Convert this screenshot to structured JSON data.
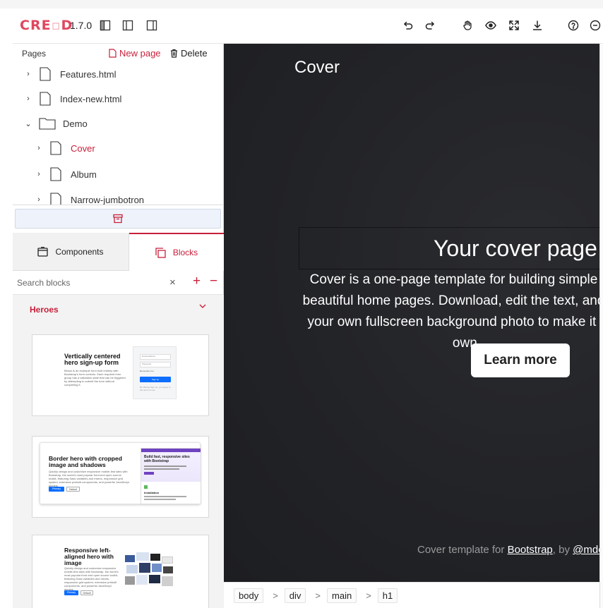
{
  "toolbar": {
    "logo_left": "CRE",
    "logo_mid": "▫",
    "logo_right": "D",
    "version": "1.7.0"
  },
  "pages": {
    "title": "Pages",
    "new_page_label": "New page",
    "delete_label": "Delete",
    "items": [
      {
        "label": "Features.html",
        "type": "file"
      },
      {
        "label": "Index-new.html",
        "type": "file"
      },
      {
        "label": "Demo",
        "type": "folder"
      },
      {
        "label": "Cover",
        "type": "file"
      },
      {
        "label": "Album",
        "type": "file"
      },
      {
        "label": "Narrow-jumbotron",
        "type": "file"
      }
    ]
  },
  "tabs": {
    "components_label": "Components",
    "blocks_label": "Blocks"
  },
  "search": {
    "placeholder": "Search blocks",
    "clear": "×",
    "plus": "+",
    "minus": "−"
  },
  "blocks": {
    "group_title": "Heroes",
    "cards": [
      {
        "title": "Vertically centered hero sign-up form",
        "text": "Below is an example form built entirely with Bootstrap's form controls. Each required form group has a validation state that can be triggered by attempting to submit the form without completing it.",
        "field1": "Email address",
        "field2": "Password",
        "check": "Remember me",
        "button": "Sign up",
        "note": "By clicking Sign up, you agree to the terms of use."
      },
      {
        "title": "Border hero with cropped image and shadows",
        "text": "Quickly design and customize responsive mobile-first sites with Bootstrap, the world's most popular front-end open source toolkit, featuring Sass variables and mixins, responsive grid system, extensive prebuilt components, and powerful JavaScript plugins.",
        "primary": "Primary",
        "default": "Default",
        "shot_title": "Build fast, responsive sites with Bootstrap",
        "shot_sub": "Installation"
      },
      {
        "title": "Responsive left-aligned hero with image",
        "text": "Quickly design and customize responsive mobile-first sites with Bootstrap, the world's most popular front-end open source toolkit, featuring Sass variables and mixins, responsive grid system, extensive prebuilt components, and powerful JavaScript plugins.",
        "primary": "Primary",
        "default": "Default"
      }
    ]
  },
  "canvas": {
    "brand": "Cover",
    "heading": "Your cover page",
    "lead": "Cover is a one-page template for building simple and beautiful home pages. Download, edit the text, and add your own fullscreen background photo to make it your own.",
    "button": "Learn more",
    "footer_prefix": "Cover template for ",
    "footer_link": "Bootstrap",
    "footer_mid": ", by ",
    "footer_handle": "@mdo"
  },
  "breadcrumb": {
    "items": [
      "body",
      "div",
      "main",
      "h1"
    ],
    "separator": ">"
  },
  "colors": {
    "accent": "#c8203a",
    "canvas_bg": "#222327",
    "trash_bg": "#eef3fb"
  }
}
